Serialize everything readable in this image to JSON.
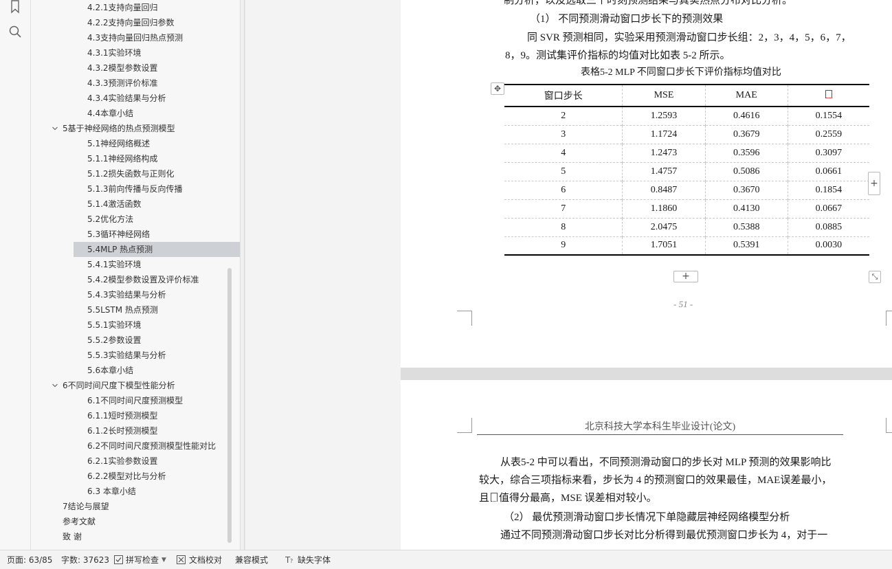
{
  "nav": {
    "toc": [
      {
        "label": "4.2.1支持向量回归",
        "level": 3
      },
      {
        "label": "4.2.2支持向量回归参数",
        "level": 3
      },
      {
        "label": "4.3支持向量回归热点预测",
        "level": 2
      },
      {
        "label": "4.3.1实验环境",
        "level": 3
      },
      {
        "label": "4.3.2模型参数设置",
        "level": 3
      },
      {
        "label": "4.3.3预测评价标准",
        "level": 3
      },
      {
        "label": "4.3.4实验结果与分析",
        "level": 3
      },
      {
        "label": "4.4本章小结",
        "level": 2
      },
      {
        "label": "5基于神经网络的热点预测模型",
        "level": 1,
        "expanded": true
      },
      {
        "label": "5.1神经网络概述",
        "level": 2
      },
      {
        "label": "5.1.1神经网络构成",
        "level": 3
      },
      {
        "label": "5.1.2损失函数与正则化",
        "level": 3
      },
      {
        "label": "5.1.3前向传播与反向传播",
        "level": 3
      },
      {
        "label": "5.1.4激活函数",
        "level": 3
      },
      {
        "label": "5.2优化方法",
        "level": 2
      },
      {
        "label": "5.3循环神经网络",
        "level": 2
      },
      {
        "label": "5.4MLP 热点预测",
        "level": 2,
        "active": true
      },
      {
        "label": "5.4.1实验环境",
        "level": 3
      },
      {
        "label": "5.4.2模型参数设置及评价标准",
        "level": 3
      },
      {
        "label": "5.4.3实验结果与分析",
        "level": 3
      },
      {
        "label": "5.5LSTM 热点预测",
        "level": 2
      },
      {
        "label": "5.5.1实验环境",
        "level": 3
      },
      {
        "label": "5.5.2参数设置",
        "level": 3
      },
      {
        "label": "5.5.3实验结果与分析",
        "level": 3
      },
      {
        "label": "5.6本章小结",
        "level": 2
      },
      {
        "label": "6不同时间尺度下模型性能分析",
        "level": 1,
        "expanded": true
      },
      {
        "label": "6.1不同时间尺度预测模型",
        "level": 2
      },
      {
        "label": "6.1.1短时预测模型",
        "level": 3
      },
      {
        "label": "6.1.2长时预测模型",
        "level": 3
      },
      {
        "label": "6.2不同时间尺度预测模型性能对比",
        "level": 2
      },
      {
        "label": "6.2.1实验参数设置",
        "level": 3
      },
      {
        "label": "6.2.2模型对比与分析",
        "level": 3
      },
      {
        "label": "6.3 本章小结",
        "level": 2
      },
      {
        "label": "7结论与展望",
        "level": 1
      },
      {
        "label": "参考文献",
        "level": 1
      },
      {
        "label": "致 谢",
        "level": 1
      }
    ]
  },
  "page1": {
    "line_top": "制分析，以及选取三个时刻预测结果与真实热点分布对比分析。",
    "heading": "（1） 不同预测滑动窗口步长下的预测效果",
    "p1_line1": "同 SVR 预测相同，实验采用预测滑动窗口步长组：2，3，4，5，6，7，",
    "p1_line2": "8，9。测试集评价指标的均值对比如表 5-2 所示。",
    "caption": "表格5-2    MLP 不同窗口步长下评价指标均值对比",
    "table": {
      "headers": [
        "窗口步长",
        "MSE",
        "MAE",
        "R²"
      ],
      "rows": [
        [
          "2",
          "1.2593",
          "0.4616",
          "0.1554"
        ],
        [
          "3",
          "1.1724",
          "0.3679",
          "0.2559"
        ],
        [
          "4",
          "1.2473",
          "0.3596",
          "0.3097"
        ],
        [
          "5",
          "1.4757",
          "0.5086",
          "0.0661"
        ],
        [
          "6",
          "0.8487",
          "0.3670",
          "0.1854"
        ],
        [
          "7",
          "1.1860",
          "0.4130",
          "0.0667"
        ],
        [
          "8",
          "2.0475",
          "0.5388",
          "0.0885"
        ],
        [
          "9",
          "1.7051",
          "0.5391",
          "0.0030"
        ]
      ]
    },
    "page_number": "- 51 -"
  },
  "page2": {
    "header": "北京科技大学本科生毕业设计(论文)",
    "p1_line1": "从表5-2 中可以看出，不同预测滑动窗口的步长对 MLP 预测的效果影响比",
    "p1_line2": "较大，综合三项指标来看，步长为 4 的预测窗口的效果最佳，MAE误差最小，",
    "p1_line3_a": "且",
    "p1_line3_b": "值得分最高，MSE 误差相对较小。",
    "heading2": "（2） 最优预测滑动窗口步长情况下单隐藏层神经网络模型分析",
    "p2_line1": "通过不同预测滑动窗口步长对比分析得到最优预测窗口步长为 4，对于一"
  },
  "statusbar": {
    "page": "页面: 63/85",
    "words": "字数: 37623",
    "spell": "拼写检查",
    "proof": "文档校对",
    "compat": "兼容模式",
    "font": "缺失字体"
  }
}
